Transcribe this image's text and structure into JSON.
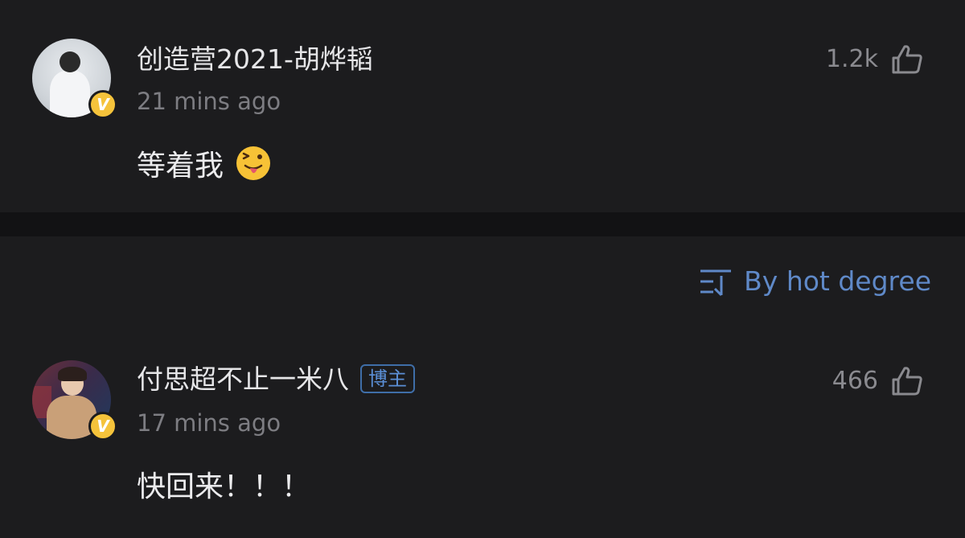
{
  "comments": [
    {
      "username": "创造营2021-胡烨韬",
      "time": "21 mins ago",
      "text": "等着我",
      "emoji": "winking-tongue-emoji",
      "likes": "1.2k",
      "verified": true
    },
    {
      "username": "付思超不止一米八",
      "author_tag": "博主",
      "time": "17 mins ago",
      "text": "快回来！！！",
      "likes": "466",
      "verified": true
    }
  ],
  "sort": {
    "label": "By hot degree",
    "icon": "sort-icon"
  },
  "colors": {
    "background": "#1c1c1e",
    "separator": "#121214",
    "accent_blue": "#5f89c8",
    "verified_badge": "#f5c33b",
    "username": "#e6e6e8",
    "timestamp": "#7d7d82"
  },
  "icons": {
    "like": "thumbs-up-icon",
    "verified": "verified-v-icon"
  }
}
